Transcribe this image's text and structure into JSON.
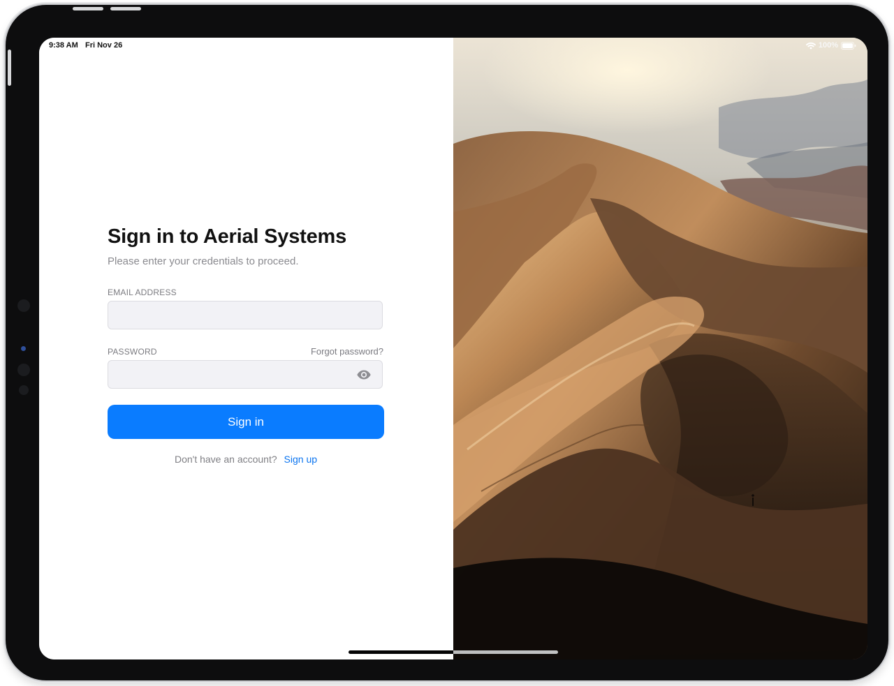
{
  "status_bar": {
    "time": "9:38 AM",
    "date": "Fri Nov 26",
    "battery": "100%",
    "wifi_icon": "wifi-icon",
    "battery_icon": "battery-full-icon"
  },
  "login": {
    "title": "Sign in to Aerial Systems",
    "subtitle": "Please enter your credentials to proceed.",
    "email_label": "EMAIL ADDRESS",
    "email_value": "",
    "email_placeholder": "",
    "password_label": "PASSWORD",
    "password_value": "",
    "password_placeholder": "",
    "forgot_password": "Forgot password?",
    "show_password_icon": "eye-icon",
    "sign_in_button": "Sign in",
    "account_prompt": "Don't have an account?",
    "sign_up_link": "Sign up"
  },
  "image": {
    "subject": "desert-dunes"
  },
  "colors": {
    "primary_button": "#0a7cff",
    "link": "#0a74f0",
    "input_background": "#f2f2f6",
    "text_primary": "#111111",
    "text_secondary": "#8a8a8f"
  }
}
